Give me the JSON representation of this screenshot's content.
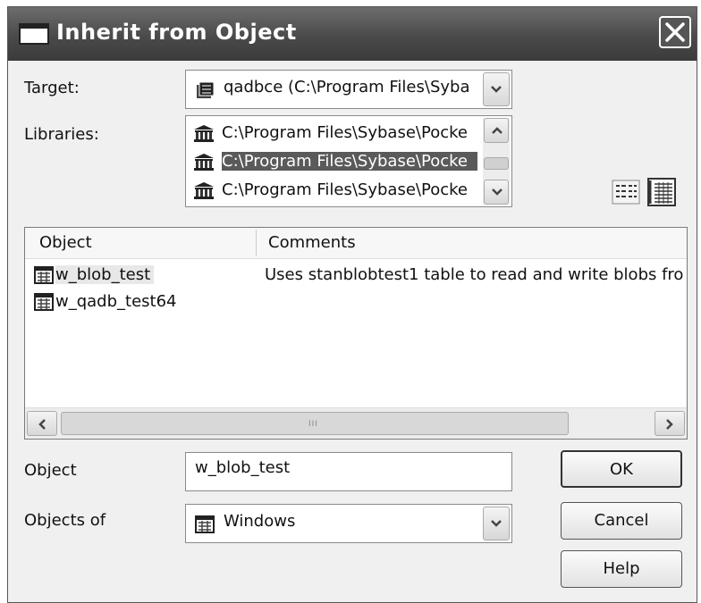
{
  "window": {
    "title": "Inherit from Object",
    "close_label": "close"
  },
  "target": {
    "label": "Target:",
    "value": "qadbce (C:\\Program Files\\Syba",
    "icon": "database-icon"
  },
  "libraries": {
    "label": "Libraries:",
    "items": [
      {
        "label": "C:\\Program Files\\Sybase\\Pocke",
        "selected": false,
        "icon": "library-icon"
      },
      {
        "label": "C:\\Program Files\\Sybase\\Pocke",
        "selected": true,
        "icon": "library-icon"
      },
      {
        "label": "C:\\Program Files\\Sybase\\Pocke",
        "selected": false,
        "icon": "library-icon"
      }
    ],
    "view_modes": [
      "list-view-icon",
      "details-view-icon"
    ]
  },
  "objects_grid": {
    "columns": [
      "Object",
      "Comments"
    ],
    "rows": [
      {
        "name": "w_blob_test",
        "comment": "Uses stanblobtest1 table to read and write blobs fro",
        "selected": true,
        "icon": "window-icon"
      },
      {
        "name": "w_qadb_test64",
        "comment": "",
        "selected": false,
        "icon": "window-icon"
      }
    ],
    "scroll_grip": "III"
  },
  "object_field": {
    "label": "Object",
    "value": "w_blob_test"
  },
  "objects_of": {
    "label": "Objects of",
    "value": "Windows",
    "icon": "window-icon"
  },
  "buttons": {
    "ok": "OK",
    "cancel": "Cancel",
    "help": "Help"
  },
  "colors": {
    "titlebar": "#4a4a4a",
    "selection": "#5a5a5a",
    "dialog_bg": "#f0f0f0"
  }
}
